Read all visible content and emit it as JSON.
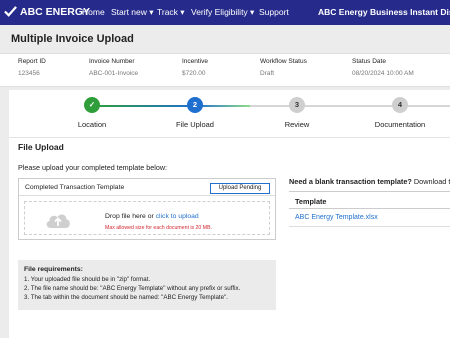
{
  "nav": {
    "brand": "ABC ENERGY",
    "items": [
      "Home",
      "Start new ▾",
      "Track ▾",
      "Verify Eligibility ▾",
      "Support"
    ],
    "right_title": "ABC Energy Business Instant Discount Pr",
    "bg_color": "#262a8a"
  },
  "page": {
    "title": "Multiple Invoice Upload"
  },
  "meta": [
    {
      "label": "Report ID",
      "value": "123456"
    },
    {
      "label": "Invoice Number",
      "value": "ABC-001-Invoice"
    },
    {
      "label": "Incentive",
      "value": "$720.00"
    },
    {
      "label": "Workflow Status",
      "value": "Draft"
    },
    {
      "label": "Status Date",
      "value": "08/20/2024 10:00 AM"
    }
  ],
  "steps": [
    {
      "number": "✓",
      "label": "Location",
      "state": "complete"
    },
    {
      "number": "2",
      "label": "File Upload",
      "state": "active"
    },
    {
      "number": "3",
      "label": "Review",
      "state": "pending"
    },
    {
      "number": "4",
      "label": "Documentation",
      "state": "pending"
    }
  ],
  "upload": {
    "section_title": "File Upload",
    "instructions": "Please upload your completed template below:",
    "box_title": "Completed Transaction Template",
    "status_button": "Upload Pending",
    "drop_text": "Drop file here or ",
    "drop_link": "click to upload",
    "max_size": "Max allowed size for each document is 20 MB."
  },
  "requirements": {
    "title": "File requirements:",
    "items": [
      "1.  Your uploaded file should be in \"zip\" format.",
      "2.  The file name should be: \"ABC Energy Template\" without any prefix or suffix.",
      "3.  The tab within the document should be named: \"ABC Energy Template\"."
    ]
  },
  "blank_template": {
    "question": "Need a blank transaction template?",
    "suffix": " Download the",
    "column_header": "Template",
    "file_link": "ABC Energy Template.xlsx"
  },
  "colors": {
    "complete": "#2f9e3a",
    "active": "#1f6fcf",
    "pending": "#cfcfcf",
    "link": "#1f6fcf",
    "error": "#d2262e"
  }
}
